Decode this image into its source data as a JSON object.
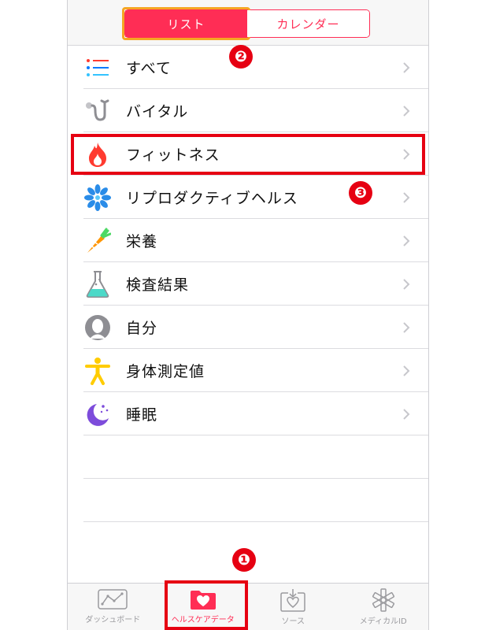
{
  "segments": {
    "list": "リスト",
    "calendar": "カレンダー"
  },
  "categories": [
    {
      "label": "すべて",
      "icon": "list-icon"
    },
    {
      "label": "バイタル",
      "icon": "stethoscope-icon"
    },
    {
      "label": "フィットネス",
      "icon": "flame-icon"
    },
    {
      "label": "リプロダクティブヘルス",
      "icon": "snowflake-flower-icon"
    },
    {
      "label": "栄養",
      "icon": "carrot-icon"
    },
    {
      "label": "検査結果",
      "icon": "flask-icon"
    },
    {
      "label": "自分",
      "icon": "person-silhouette-icon"
    },
    {
      "label": "身体測定値",
      "icon": "body-figure-icon"
    },
    {
      "label": "睡眠",
      "icon": "moon-stars-icon"
    }
  ],
  "tabs": [
    {
      "label": "ダッシュボード",
      "icon": "dashboard-chart-icon"
    },
    {
      "label": "ヘルスケアデータ",
      "icon": "health-folder-icon"
    },
    {
      "label": "ソース",
      "icon": "download-heart-icon"
    },
    {
      "label": "メディカルID",
      "icon": "medical-asterisk-icon"
    }
  ],
  "annotations": {
    "step1": "❶",
    "step2": "❷",
    "step3": "❸"
  },
  "colors": {
    "accent": "#ff2d55",
    "highlight_red": "#e60012",
    "highlight_orange": "#f5a623"
  }
}
